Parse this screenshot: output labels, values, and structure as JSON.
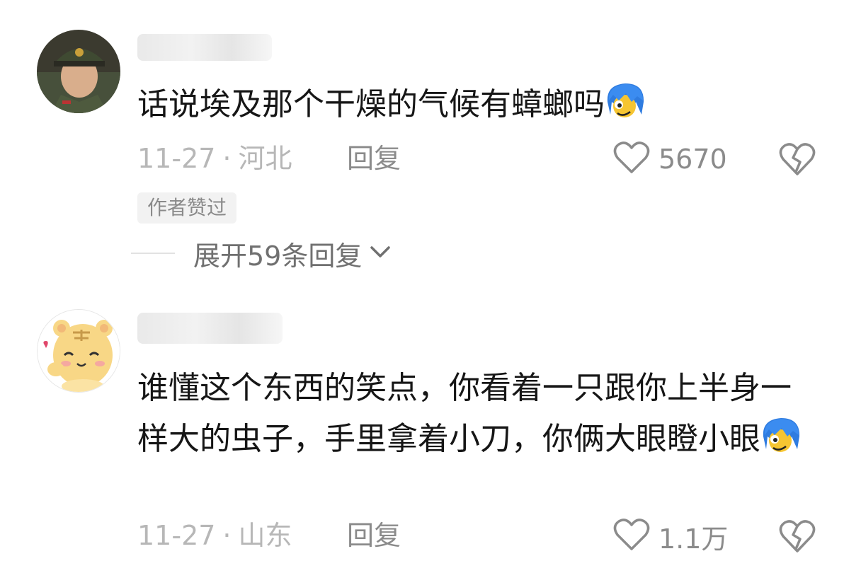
{
  "comments": [
    {
      "text": "话说埃及那个干燥的气候有蟑螂吗",
      "date": "11-27",
      "location": "河北",
      "reply_label": "回复",
      "likes": "5670",
      "author_badge": "作者赞过",
      "expand_label": "展开59条回复",
      "emoji": "blue-hair-emoji"
    },
    {
      "text": "谁懂这个东西的笑点，你看着一只跟你上半身一样大的虫子，手里拿着小刀，你俩大眼瞪小眼",
      "date": "11-27",
      "location": "山东",
      "reply_label": "回复",
      "likes": "1.1万",
      "emoji": "blue-hair-emoji"
    }
  ],
  "meta_separator": "·",
  "icons": {
    "like": "heart-outline-icon",
    "dislike": "broken-heart-icon",
    "expand": "chevron-down-icon"
  },
  "colors": {
    "text": "#161616",
    "meta": "#b7b7b7",
    "action": "#8b8b8b",
    "badge_bg": "#f2f2f2"
  }
}
